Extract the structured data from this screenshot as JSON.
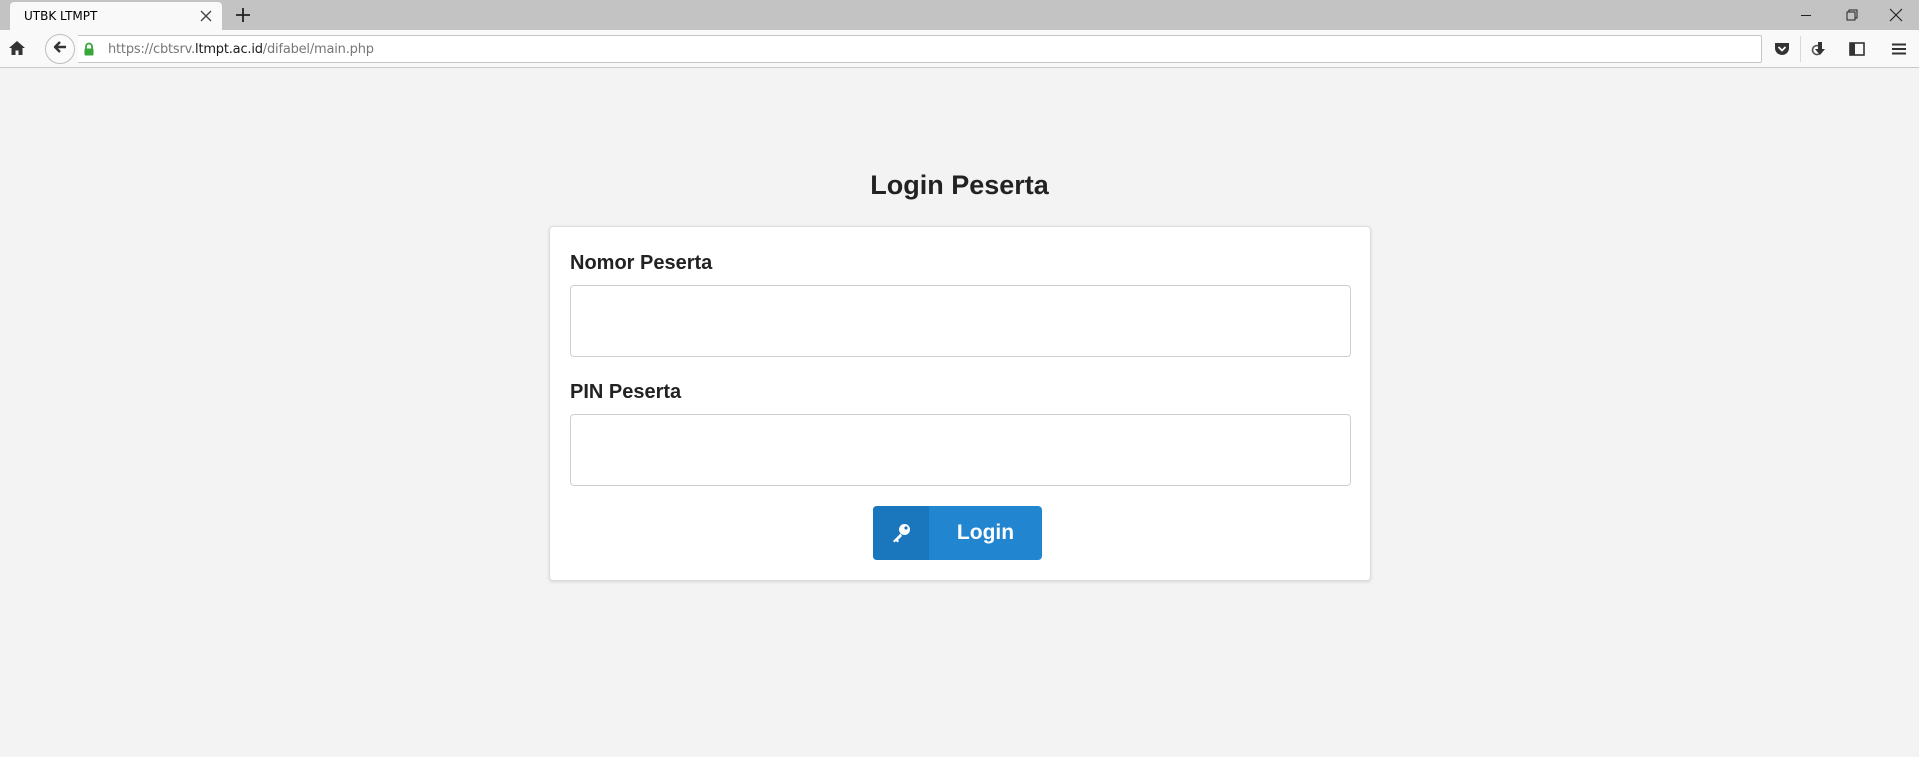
{
  "browser": {
    "tab_title": "UTBK LTMPT",
    "url": {
      "prefix": "https://cbtsrv.",
      "host": "ltmpt.ac.id",
      "path": "/difabel/main.php"
    }
  },
  "page": {
    "title": "Login Peserta",
    "fields": [
      {
        "label": "Nomor Peserta",
        "value": "",
        "placeholder": ""
      },
      {
        "label": "PIN Peserta",
        "value": "",
        "placeholder": ""
      }
    ],
    "login_button": {
      "label": "Login",
      "icon": "key-icon"
    }
  },
  "colors": {
    "primary": "#2185d0",
    "primary_dark": "#1a76bd",
    "background": "#f3f3f3"
  }
}
